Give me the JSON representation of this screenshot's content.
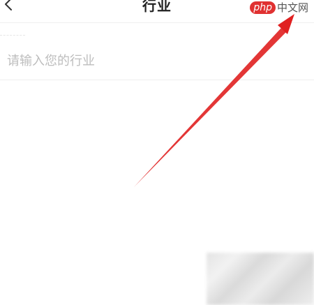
{
  "header": {
    "title": "行业",
    "back_icon": "chevron-left-icon"
  },
  "watermark": {
    "logo": "php",
    "text": "中文网"
  },
  "form": {
    "industry_placeholder": "请输入您的行业",
    "industry_value": ""
  },
  "annotation": {
    "arrow_color": "#e02020"
  }
}
